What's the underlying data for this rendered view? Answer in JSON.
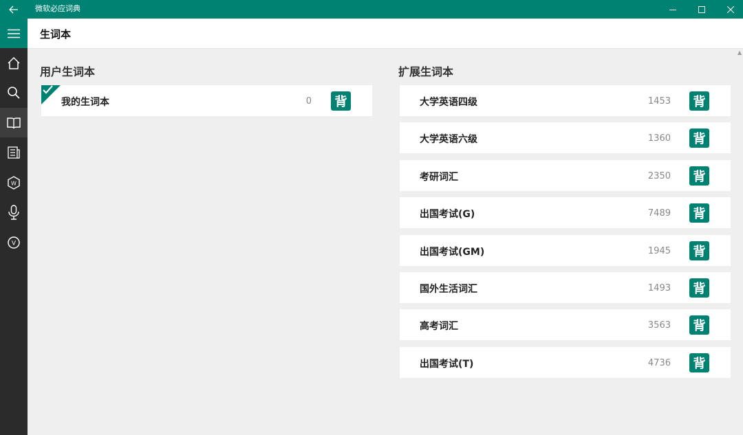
{
  "window": {
    "title": "微软必应词典"
  },
  "header": {
    "title": "生词本"
  },
  "sidebar": {
    "items": [
      {
        "name": "home-icon"
      },
      {
        "name": "search-icon"
      },
      {
        "name": "book-icon",
        "active": true
      },
      {
        "name": "news-icon"
      },
      {
        "name": "w-badge-icon"
      },
      {
        "name": "microphone-icon"
      },
      {
        "name": "v-badge-icon"
      }
    ]
  },
  "user_section": {
    "title": "用户生词本",
    "items": [
      {
        "name": "我的生词本",
        "count": "0",
        "action": "背"
      }
    ]
  },
  "ext_section": {
    "title": "扩展生词本",
    "items": [
      {
        "name": "大学英语四级",
        "count": "1453",
        "action": "背"
      },
      {
        "name": "大学英语六级",
        "count": "1360",
        "action": "背"
      },
      {
        "name": "考研词汇",
        "count": "2350",
        "action": "背"
      },
      {
        "name": "出国考试(G)",
        "count": "7489",
        "action": "背"
      },
      {
        "name": "出国考试(GM)",
        "count": "1945",
        "action": "背"
      },
      {
        "name": "国外生活词汇",
        "count": "1493",
        "action": "背"
      },
      {
        "name": "高考词汇",
        "count": "3563",
        "action": "背"
      },
      {
        "name": "出国考试(T)",
        "count": "4736",
        "action": "背"
      }
    ]
  },
  "colors": {
    "accent": "#008272",
    "sidebar": "#2b2b2b",
    "background": "#efefef"
  }
}
